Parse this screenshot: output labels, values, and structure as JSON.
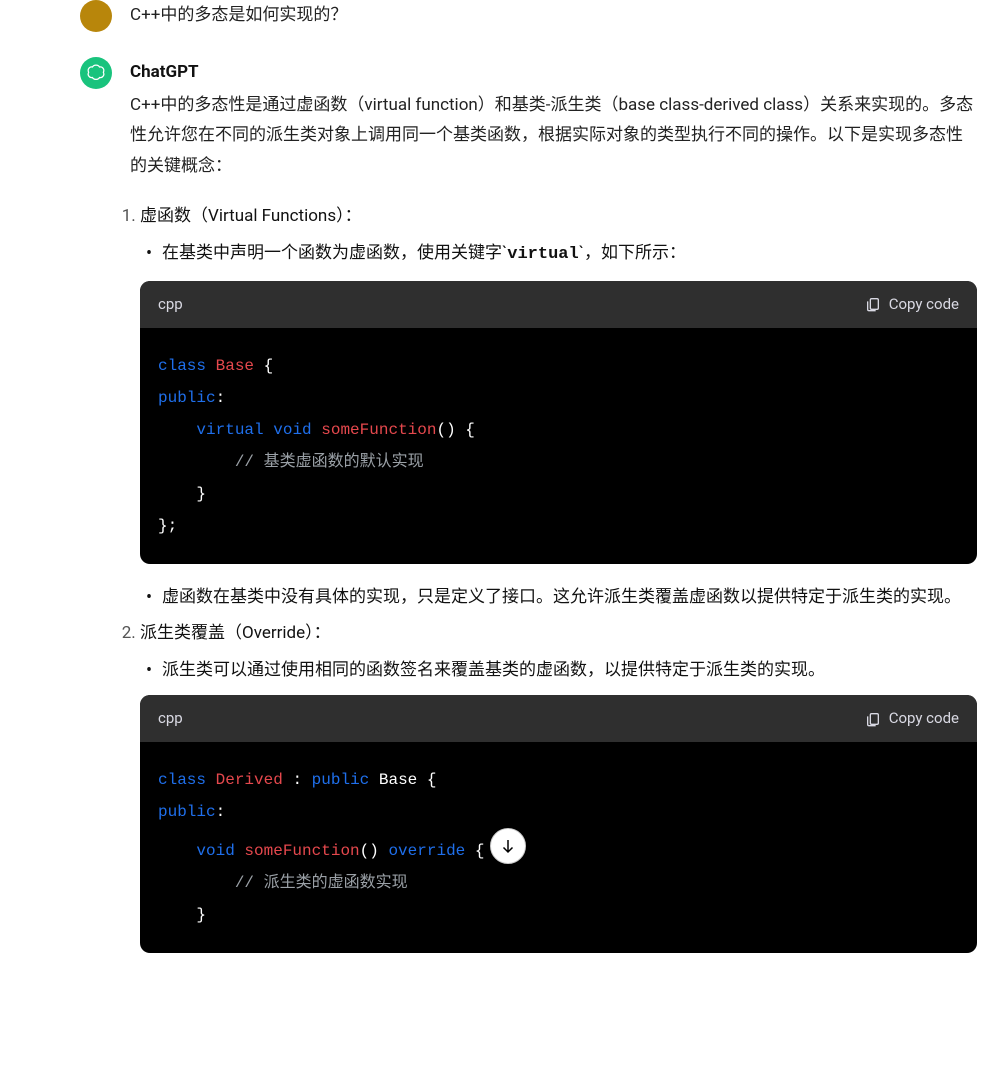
{
  "user": {
    "question": "C++中的多态是如何实现的？"
  },
  "assistant": {
    "name": "ChatGPT",
    "intro": "C++中的多态性是通过虚函数（virtual function）和基类-派生类（base class-derived class）关系来实现的。多态性允许您在不同的派生类对象上调用同一个基类函数，根据实际对象的类型执行不同的操作。以下是实现多态性的关键概念：",
    "steps": [
      {
        "title": "虚函数（Virtual Functions）：",
        "bullets": [
          {
            "pre": "在基类中声明一个函数为虚函数，使用关键字`",
            "code": "virtual",
            "post": "`，如下所示："
          }
        ],
        "code_lang": "cpp",
        "copy_label": "Copy code",
        "code": {
          "l1": {
            "kw": "class",
            "id": "Base",
            "p1": " {"
          },
          "l2": {
            "kw": "public",
            "p1": ":"
          },
          "l3": {
            "kw1": "virtual",
            "kw2": "void",
            "fn": "someFunction",
            "p1": "()",
            "p2": " {"
          },
          "l4": {
            "cmt": "// 基类虚函数的默认实现"
          },
          "l5": {
            "p1": "}"
          },
          "l6": {
            "p1": "};"
          }
        },
        "bullets_after": [
          "虚函数在基类中没有具体的实现，只是定义了接口。这允许派生类覆盖虚函数以提供特定于派生类的实现。"
        ]
      },
      {
        "title": "派生类覆盖（Override）：",
        "bullets": [
          {
            "text": "派生类可以通过使用相同的函数签名来覆盖基类的虚函数，以提供特定于派生类的实现。"
          }
        ],
        "code_lang": "cpp",
        "copy_label": "Copy code",
        "code": {
          "l1": {
            "kw": "class",
            "id1": "Derived",
            "p1": " : ",
            "kw2": "public",
            "id2": "Base",
            "p2": " {"
          },
          "l2": {
            "kw": "public",
            "p1": ":"
          },
          "l3": {
            "kw2": "void",
            "fn": "someFunction",
            "p1": "()",
            "kw3": "override",
            "p2": " {"
          },
          "l4": {
            "cmt": "// 派生类的虚函数实现"
          },
          "l5": {
            "p1": "}"
          }
        }
      }
    ]
  }
}
